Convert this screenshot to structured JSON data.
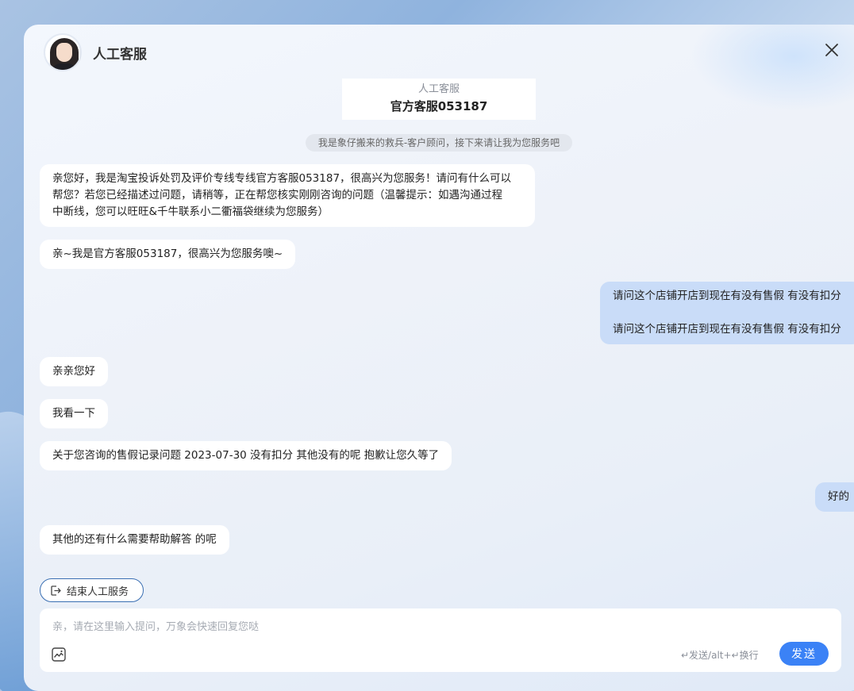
{
  "header": {
    "title": "人工客服"
  },
  "agent_card": {
    "subtitle": "人工客服",
    "name": "官方客服053187"
  },
  "system_note": "我是象仔搬来的救兵-客户顾问，接下来请让我为您服务吧",
  "messages": [
    {
      "side": "left",
      "text": "亲您好，我是淘宝投诉处罚及评价专线专线官方客服053187，很高兴为您服务！请问有什么可以\n帮您？若您已经描述过问题，请稍等，正在帮您核实刚刚咨询的问题（温馨提示：如遇沟通过程\n中断线，您可以旺旺&千牛联系小二衢福袋继续为您服务）"
    },
    {
      "side": "left",
      "text": "亲~我是官方客服053187，很高兴为您服务噢~"
    },
    {
      "side": "right",
      "text": "请问这个店铺开店到现在有没有售假 有没有扣分\n\n请问这个店铺开店到现在有没有售假 有没有扣分"
    },
    {
      "side": "left",
      "text": "亲亲您好"
    },
    {
      "side": "left",
      "text": "我看一下"
    },
    {
      "side": "left",
      "text": "关于您咨询的售假记录问题 2023-07-30 没有扣分 其他没有的呢 抱歉让您久等了"
    },
    {
      "side": "right",
      "text": "好的"
    },
    {
      "side": "left",
      "text": "其他的还有什么需要帮助解答 的呢"
    }
  ],
  "end_service_label": "结束人工服务",
  "input": {
    "placeholder": "亲，请在这里输入提问，万象会快速回复您哒",
    "value": ""
  },
  "shortcut_hint": "↵发送/alt+↵换行",
  "send_label": "发送",
  "colors": {
    "accent": "#3b82f6",
    "user_bubble": "#c9dcf8",
    "agent_bubble": "#ffffff"
  }
}
